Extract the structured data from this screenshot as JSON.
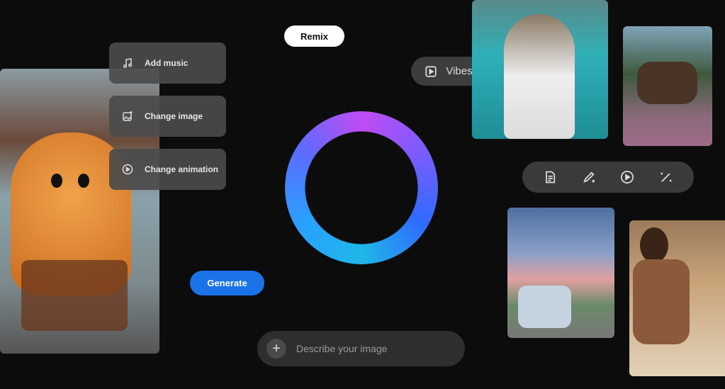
{
  "menu": [
    {
      "label": "Add music",
      "icon": "music-note-icon"
    },
    {
      "label": "Change image",
      "icon": "image-sparkle-icon"
    },
    {
      "label": "Change animation",
      "icon": "play-circle-icon"
    }
  ],
  "remix_label": "Remix",
  "vibes_label": "Vibes",
  "generate_label": "Generate",
  "prompt": {
    "placeholder": "Describe your image"
  },
  "toolbar": [
    "document-icon",
    "pencil-sparkle-icon",
    "play-circle-icon",
    "magic-wand-icon"
  ],
  "colors": {
    "bg": "#0c0c0c",
    "generate": "#1a73e8",
    "ring_from": "#2f6bff",
    "ring_to": "#c04cf2"
  }
}
